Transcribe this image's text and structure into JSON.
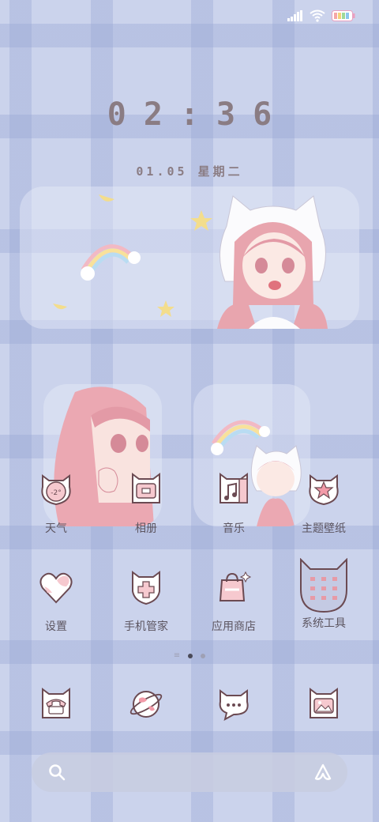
{
  "status": {
    "signal_icon": "signal-icon",
    "wifi_icon": "wifi-icon",
    "battery_icon": "battery-icon"
  },
  "clock": {
    "time": "02:36",
    "date": "01.05 星期二"
  },
  "apps": [
    {
      "label": "天气",
      "icon": "weather-icon",
      "badge": "-2°"
    },
    {
      "label": "相册",
      "icon": "gallery-icon"
    },
    {
      "label": "音乐",
      "icon": "music-icon"
    },
    {
      "label": "主题壁纸",
      "icon": "themes-icon"
    },
    {
      "label": "设置",
      "icon": "settings-icon"
    },
    {
      "label": "手机管家",
      "icon": "security-icon"
    },
    {
      "label": "应用商店",
      "icon": "app-store-icon"
    },
    {
      "label": "系统工具",
      "icon": "system-tools-folder-icon"
    }
  ],
  "dock": [
    {
      "icon": "phone-icon"
    },
    {
      "icon": "browser-icon"
    },
    {
      "icon": "messages-icon"
    },
    {
      "icon": "camera-icon"
    }
  ],
  "pager": {
    "pages": 2,
    "current": 1
  },
  "search": {
    "left_icon": "search-icon",
    "right_icon": "assistant-icon"
  },
  "colors": {
    "accent_pink": "#e8a5ae",
    "icon_outline": "#6b4a52",
    "text": "#5c5560"
  }
}
